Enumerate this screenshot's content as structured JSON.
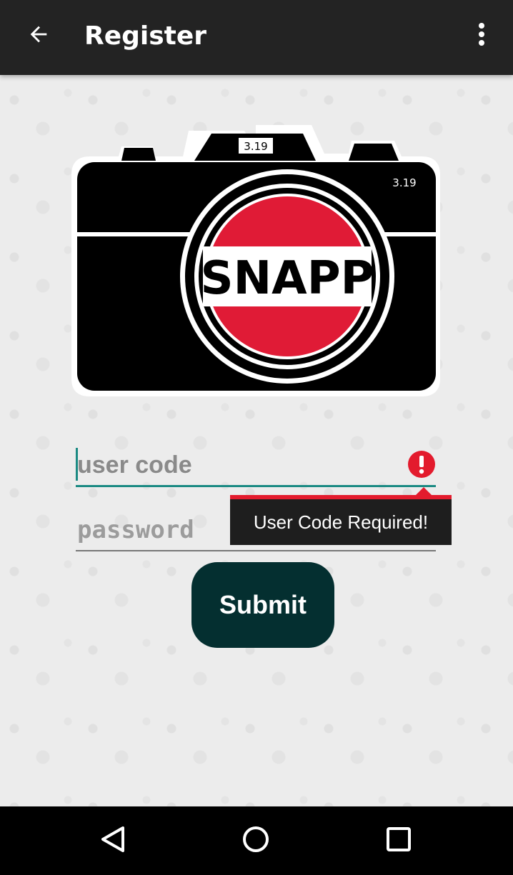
{
  "app_bar": {
    "title": "Register",
    "back_icon": "arrow-left-icon",
    "overflow_icon": "more-vert-icon",
    "background": "#232323"
  },
  "logo": {
    "brand_text": "SNAPP",
    "version_top": "3.19",
    "version_side": "3.19",
    "accent_color": "#e01b36"
  },
  "form": {
    "user_code": {
      "value": "",
      "placeholder": "user code"
    },
    "password": {
      "value": "",
      "placeholder": "password"
    },
    "error_message": "User Code Required!",
    "error_icon": "error-exclamation-icon",
    "submit_label": "Submit",
    "accent_color": "#1b8a83",
    "error_color": "#e31b2d",
    "button_color": "#042f30"
  },
  "nav_bar": {
    "back_icon": "nav-back-triangle-icon",
    "home_icon": "nav-home-circle-icon",
    "recents_icon": "nav-recents-square-icon"
  }
}
